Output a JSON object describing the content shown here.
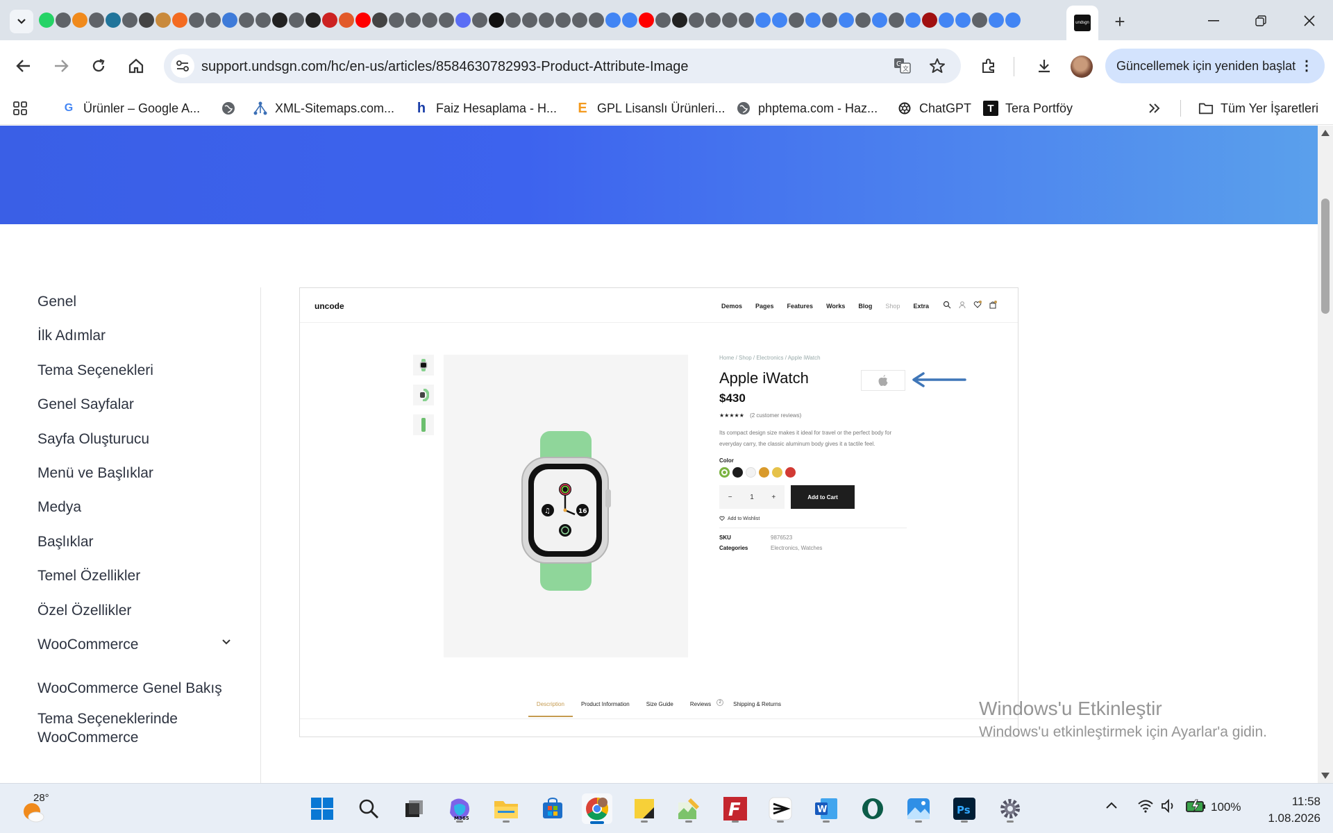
{
  "browser": {
    "active_tab_icon_label": "undsgn",
    "url": "support.undsgn.com/hc/en-us/articles/8584630782993-Product-Attribute-Image",
    "update_button_label": "Güncellemek için yeniden başlat",
    "bookmarks": [
      {
        "label": "Ürünler – Google A...",
        "icon": "google-icon"
      },
      {
        "label": "",
        "icon": "globe-icon"
      },
      {
        "label": "XML-Sitemaps.com...",
        "icon": "sitemap-icon"
      },
      {
        "label": "Faiz Hesaplama - H...",
        "icon": "h-logo-icon"
      },
      {
        "label": "GPL Lisanslı Ürünleri...",
        "icon": "e-logo-icon"
      },
      {
        "label": "phptema.com - Haz...",
        "icon": "globe-icon"
      },
      {
        "label": "ChatGPT",
        "icon": "chatgpt-icon"
      },
      {
        "label": "Tera Portföy",
        "icon": "t-logo-icon"
      }
    ],
    "all_bookmarks_label": "Tüm Yer İşaretleri"
  },
  "sidebar": {
    "items": [
      {
        "label": "Genel"
      },
      {
        "label": "İlk Adımlar"
      },
      {
        "label": "Tema Seçenekleri"
      },
      {
        "label": "Genel Sayfalar"
      },
      {
        "label": "Sayfa Oluşturucu"
      },
      {
        "label": "Menü ve Başlıklar"
      },
      {
        "label": "Medya"
      },
      {
        "label": "Başlıklar"
      },
      {
        "label": "Temel Özellikler"
      },
      {
        "label": "Özel Özellikler"
      },
      {
        "label": "WooCommerce"
      }
    ],
    "sub_items": [
      {
        "label": "WooCommerce Genel Bakış"
      },
      {
        "label": "Tema Seçeneklerinde WooCommerce"
      }
    ]
  },
  "screenshot": {
    "logo": "uncode",
    "menu": [
      "Demos",
      "Pages",
      "Features",
      "Works",
      "Blog",
      "Shop",
      "Extra"
    ],
    "breadcrumb": "Home / Shop / Electronics / Apple iWatch",
    "title": "Apple iWatch",
    "price": "$430",
    "rating_stars": "★★★★★",
    "reviews": "(2 customer reviews)",
    "description": "Its compact design size makes it ideal for travel or the perfect body for everyday carry, the classic aluminum body gives it a tactile feel.",
    "color_label": "Color",
    "colors": [
      "#7cb342",
      "#1c1c1c",
      "#f2f2f2",
      "#d99a2b",
      "#e6c24a",
      "#d23a34"
    ],
    "qty_minus": "−",
    "qty_value": "1",
    "qty_plus": "+",
    "add_to_cart": "Add to Cart",
    "wishlist": "Add to Wishlist",
    "sku_label": "SKU",
    "sku_value": "9876523",
    "categories_label": "Categories",
    "categories_value": "Electronics, Watches",
    "tabs": [
      "Description",
      "Product Information",
      "Size Guide",
      "Reviews",
      "Shipping & Returns"
    ],
    "reviews_badge": "2",
    "watch_face_date": "16"
  },
  "watermark": {
    "line1": "Windows'u Etkinleştir",
    "line2": "Windows'u etkinleştirmek için Ayarlar'a gidin."
  },
  "taskbar": {
    "temperature": "28°",
    "battery": "100%",
    "time": "11:58",
    "date": "1.08.2026"
  }
}
